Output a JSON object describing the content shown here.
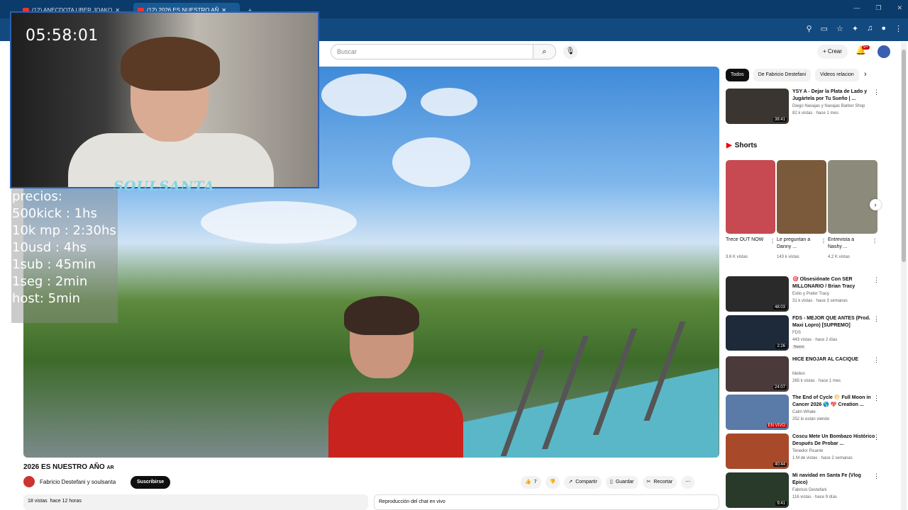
{
  "browser": {
    "tabs": [
      {
        "label": "(12) ANECDOTA UBER JOAKO",
        "active": false
      },
      {
        "label": "(12) 2026 ES NUESTRO AÑ",
        "active": true
      }
    ],
    "new_tab": "+"
  },
  "overlay": {
    "timer": "05:58:01",
    "logo_text": "SOULSANTA",
    "prices": [
      "precios:",
      "500kick : 1hs",
      "10k mp : 2:30hs",
      "10usd : 4hs",
      "1sub : 45min",
      "1seg : 2min",
      "host: 5min"
    ]
  },
  "youtube": {
    "search_placeholder": "Buscar",
    "create_label": "Crear",
    "notif_count": "9+",
    "video": {
      "title": "2026 ES NUESTRO AÑO",
      "title_badge": "AR",
      "channel": "Fabricio Destefani y soulsanta",
      "subscribe": "Suscribirse",
      "likes": "7",
      "share": "Compartir",
      "save": "Guardar",
      "clip": "Recortar",
      "views": "18 vistas",
      "posted": "hace 12 horas",
      "chat_replay": "Reproducción del chat en vivo"
    },
    "chips": [
      "Todos",
      "De Fabricio Destefani",
      "Videos relacion"
    ],
    "shorts_header": "Shorts",
    "shorts": [
      {
        "title": "Trece OUT NOW",
        "views": "3.6 K vistas",
        "color": "#c74a52"
      },
      {
        "title": "Le preguntan a Danny ...",
        "views": "143 k vistas",
        "color": "#7a5a3a"
      },
      {
        "title": "Entrevista a Nashy ...",
        "views": "4.2 K vistas",
        "color": "#8c8a7a"
      }
    ],
    "recs_top": {
      "title": "YSY A - Dejar la Plata de Lado y Jugártela por Tu Sueño | ...",
      "channel": "Diego Navajas y Navajas Barber Shop",
      "meta": "82 k vistas · hace 1 mes",
      "duration": "38:41",
      "color": "#3a3530"
    },
    "recs": [
      {
        "title": "🎯 Obsesiónate Con SER MILLONARIO / Brian Tracy",
        "channel": "Exito y Poder Tracy",
        "meta": "31 k vistas · hace 3 semanas",
        "duration": "48:03",
        "color": "#2a2a2a",
        "tag": ""
      },
      {
        "title": "FDS - MEJOR QUE ANTES (Prod. Maxi Lopro) [SUPREMO]",
        "channel": "FDS",
        "meta": "443 vistas · hace 2 días",
        "duration": "2:26",
        "color": "#1e2a3a",
        "tag": "Nuevo"
      },
      {
        "title": "HICE ENOJAR AL CACIQUE",
        "channel": "Mellon",
        "meta": "265 k vistas · hace 1 mes",
        "duration": "24:07",
        "color": "#4a3a3a",
        "tag": ""
      },
      {
        "title": "The End of Cycle 🌕 Full Moon in Cancer 2026 🌎 💖 Creation ...",
        "channel": "Calm Whale",
        "meta": "252 lo están viendo",
        "duration": "EN VIVO",
        "color": "#5a7aa8",
        "tag": ""
      },
      {
        "title": "Coscu Mete Un Bombazo Histórico Después De Probar ...",
        "channel": "Tenedor Picante",
        "meta": "1 M de vistas · hace 2 semanas",
        "duration": "40:44",
        "color": "#a84a2a",
        "tag": ""
      },
      {
        "title": "Mi navidad en Santa Fe (Vlog Epico)",
        "channel": "Fabricio Destefani",
        "meta": "116 vistas · hace 9 días",
        "duration": "9:41",
        "color": "#2a3a2a",
        "tag": ""
      }
    ]
  }
}
